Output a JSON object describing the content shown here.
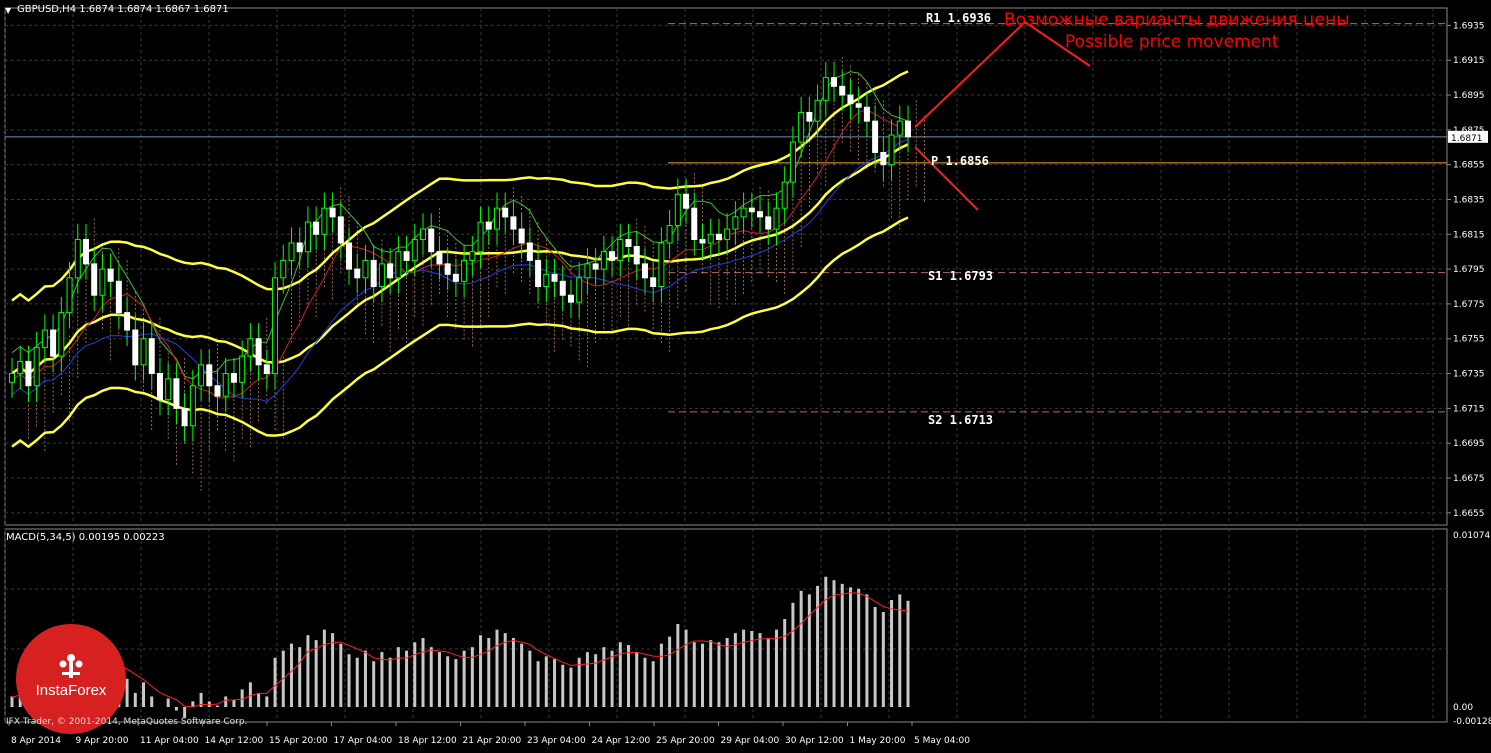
{
  "header": {
    "main_title": "GBPUSD,H4  1.6874 1.6874 1.6867 1.6871",
    "macd_title": "MACD(5,34,5) 0.00195 0.00223",
    "copyright": "IFX Trader, © 2001-2014, MetaQuotes Software Corp."
  },
  "logo": {
    "text": "InstaForex",
    "color": "#d72020"
  },
  "annotations": {
    "russian": "Возможные варианты движения цены",
    "english": "Possible price movement",
    "color": "#ff0000"
  },
  "levels": {
    "r1": {
      "label": "R1  1.6936",
      "value": 1.6936
    },
    "p": {
      "label": "P  1.6856",
      "value": 1.6856
    },
    "s1": {
      "label": "S1  1.6793",
      "value": 1.6793
    },
    "s2": {
      "label": "S2  1.6713",
      "value": 1.6713
    }
  },
  "chart_data": [
    {
      "type": "candlestick",
      "symbol": "GBPUSD",
      "timeframe": "H4",
      "current_price": 1.6871,
      "current_price_label": "1.6871",
      "ylim": [
        1.6648,
        1.6945
      ],
      "y_ticks": [
        "1.6935",
        "1.6915",
        "1.6895",
        "1.6875",
        "1.6855",
        "1.6835",
        "1.6815",
        "1.6795",
        "1.6775",
        "1.6755",
        "1.6735",
        "1.6715",
        "1.6695",
        "1.6675",
        "1.6655"
      ],
      "x_ticks": [
        "8 Apr 2014",
        "9 Apr 20:00",
        "11 Apr 04:00",
        "14 Apr 12:00",
        "15 Apr 20:00",
        "17 Apr 04:00",
        "18 Apr 12:00",
        "21 Apr 20:00",
        "23 Apr 04:00",
        "24 Apr 12:00",
        "25 Apr 20:00",
        "29 Apr 04:00",
        "30 Apr 12:00",
        "1 May 20:00",
        "5 May 04:00"
      ],
      "closes": [
        1.6735,
        1.6742,
        1.6728,
        1.675,
        1.676,
        1.6745,
        1.677,
        1.679,
        1.6812,
        1.6798,
        1.678,
        1.6795,
        1.6788,
        1.677,
        1.676,
        1.674,
        1.6755,
        1.6735,
        1.672,
        1.6732,
        1.6715,
        1.6705,
        1.6728,
        1.674,
        1.6728,
        1.6722,
        1.6735,
        1.673,
        1.6745,
        1.6755,
        1.674,
        1.6735,
        1.679,
        1.68,
        1.681,
        1.6805,
        1.6822,
        1.6815,
        1.683,
        1.6825,
        1.681,
        1.6795,
        1.679,
        1.68,
        1.6785,
        1.6798,
        1.679,
        1.6805,
        1.68,
        1.6812,
        1.6818,
        1.6805,
        1.6798,
        1.6792,
        1.6788,
        1.68,
        1.6805,
        1.6822,
        1.6818,
        1.683,
        1.6825,
        1.6818,
        1.681,
        1.68,
        1.6785,
        1.6792,
        1.6788,
        1.678,
        1.6776,
        1.679,
        1.6798,
        1.6795,
        1.6805,
        1.68,
        1.6812,
        1.6808,
        1.6798,
        1.679,
        1.6785,
        1.681,
        1.682,
        1.6838,
        1.683,
        1.6812,
        1.681,
        1.6815,
        1.6812,
        1.6818,
        1.6825,
        1.683,
        1.6828,
        1.6825,
        1.6818,
        1.683,
        1.6845,
        1.6868,
        1.6885,
        1.688,
        1.6892,
        1.6905,
        1.69,
        1.6895,
        1.689,
        1.6888,
        1.688,
        1.6862,
        1.6855,
        1.6872,
        1.688,
        1.6871
      ],
      "series": [
        {
          "name": "MACD",
          "type": "histogram",
          "color": "#c0c0c0"
        },
        {
          "name": "Signal",
          "type": "line",
          "color": "#ff0000"
        }
      ],
      "macd_panel": {
        "ylim": [
          -0.0003,
          0.01074
        ],
        "y_ticks": [
          "0.01074",
          "0.00",
          "-0.00128"
        ]
      }
    }
  ]
}
